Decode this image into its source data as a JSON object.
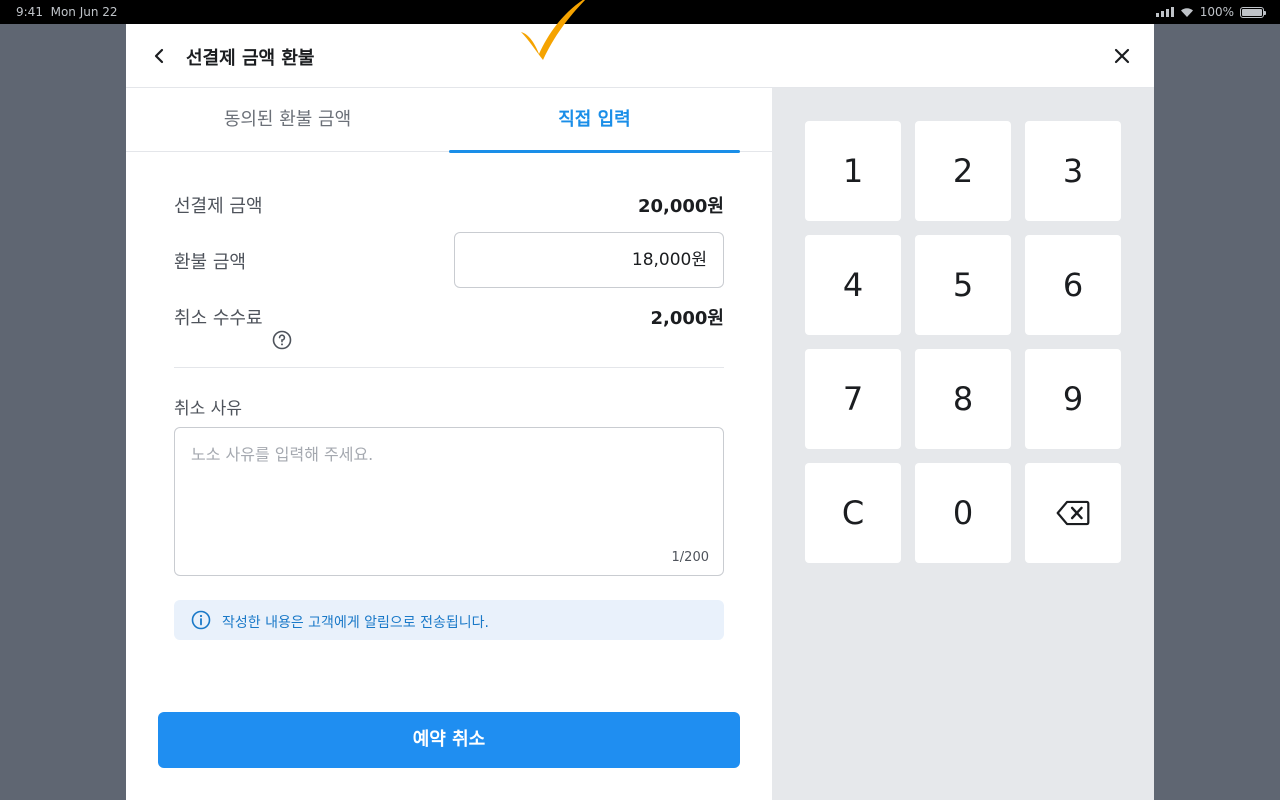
{
  "status_bar": {
    "time": "9:41",
    "date": "Mon Jun 22",
    "battery": "100%"
  },
  "header": {
    "title": "선결제 금액 환불"
  },
  "tabs": [
    {
      "label": "동의된 환불 금액",
      "active": false
    },
    {
      "label": "직접 입력",
      "active": true
    }
  ],
  "form": {
    "prepaid_label": "선결제 금액",
    "prepaid_value": "20,000원",
    "refund_label": "환불 금액",
    "refund_value": "18,000원",
    "fee_label": "취소 수수료",
    "fee_value": "2,000원",
    "reason_label": "취소 사유",
    "reason_placeholder": "노소 사유를 입력해 주세요.",
    "reason_counter": "1/200",
    "notice": "작성한 내용은 고객에게 알림으로 전송됩니다."
  },
  "submit_label": "예약 취소",
  "keypad": {
    "keys": [
      "1",
      "2",
      "3",
      "4",
      "5",
      "6",
      "7",
      "8",
      "9",
      "C",
      "0"
    ]
  },
  "colors": {
    "accent": "#1f8ef1",
    "check": "#f5a300"
  }
}
